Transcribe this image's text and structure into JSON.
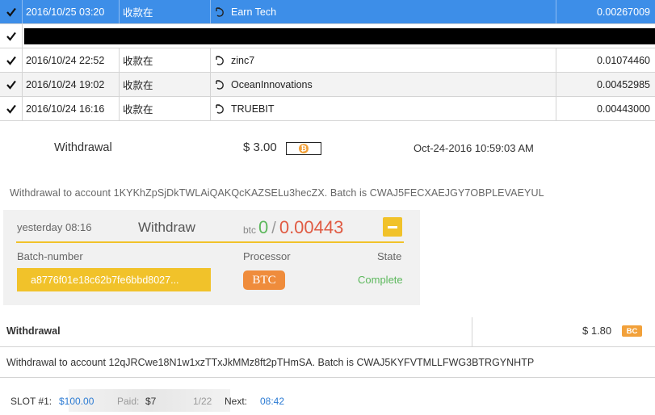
{
  "transactions": [
    {
      "date": "2016/10/25 03:20",
      "type": "收款在",
      "name": "Earn Tech",
      "amount": "0.00267009",
      "selected": true
    },
    {
      "date": "",
      "type": "",
      "name": "",
      "amount": "",
      "redacted": true
    },
    {
      "date": "2016/10/24 22:52",
      "type": "收款在",
      "name": "zinc7",
      "amount": "0.01074460"
    },
    {
      "date": "2016/10/24 19:02",
      "type": "收款在",
      "name": "OceanInnovations",
      "amount": "0.00452985"
    },
    {
      "date": "2016/10/24 16:16",
      "type": "收款在",
      "name": "TRUEBIT",
      "amount": "0.00443000"
    }
  ],
  "withdrawal1": {
    "label": "Withdrawal",
    "amount": "$ 3.00",
    "coin_symbol": "₿",
    "datetime": "Oct-24-2016 10:59:03 AM",
    "note": "Withdrawal to account 1KYKhZpSjDkTWLAiQAKQcKAZSELu3hecZX. Batch is CWAJ5FECXAEJGY7OBPLEVAEYUL"
  },
  "card": {
    "time": "yesterday 08:16",
    "title": "Withdraw",
    "currency": "btc",
    "received": "0",
    "separator": "/",
    "total": "0.00443",
    "batch_header": "Batch-number",
    "processor_header": "Processor",
    "state_header": "State",
    "batch_number": "a8776f01e18c62b7fe6bbd8027...",
    "processor": "BTC",
    "state": "Complete",
    "colors": {
      "accent": "#f1c22a",
      "processor": "#ef8c3c",
      "complete": "#5cb85c",
      "total": "#e05b43"
    }
  },
  "withdrawal2": {
    "label": "Withdrawal",
    "amount": "$ 1.80",
    "badge": "BC",
    "note": "Withdrawal to account 12qJRCwe18N1w1xzTTxJkMMz8ft2pTHmSA. Batch is CWAJ5KYFVTMLLFWG3BTRGYNHTP"
  },
  "slot": {
    "label": "SLOT #1:",
    "value": "$100.00",
    "paid_label": "Paid:",
    "paid_value": "$7",
    "progress": "1/22",
    "next_label": "Next:",
    "next_value": "08:42"
  }
}
